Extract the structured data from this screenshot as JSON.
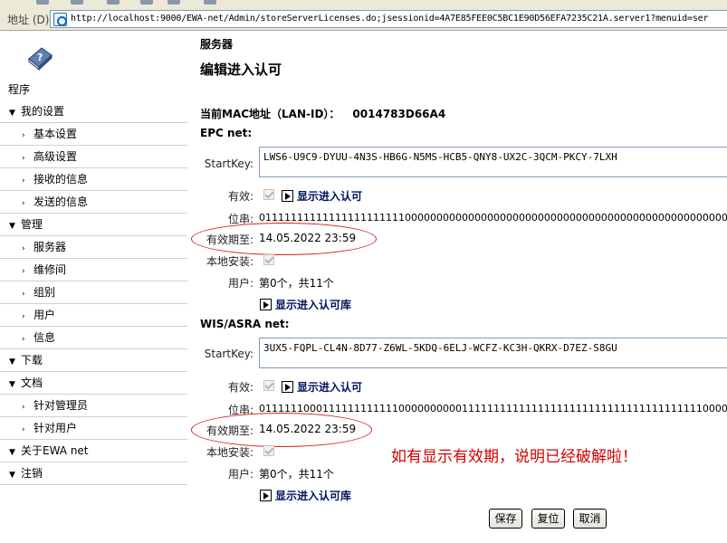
{
  "browser": {
    "address_label": "地址 (D)",
    "url": "http://localhost:9000/EWA-net/Admin/storeServerLicenses.do;jsessionid=4A7E85FEE0C5BC1E90D56EFA7235C21A.server1?menuid=ser"
  },
  "sidebar": {
    "logo_label": "程序",
    "items": [
      {
        "label": "我的设置",
        "level": "top",
        "marker": "▼"
      },
      {
        "label": "基本设置",
        "level": "sub",
        "marker": "›"
      },
      {
        "label": "高级设置",
        "level": "sub",
        "marker": "›"
      },
      {
        "label": "接收的信息",
        "level": "sub",
        "marker": "›"
      },
      {
        "label": "发送的信息",
        "level": "sub",
        "marker": "›"
      },
      {
        "label": "管理",
        "level": "top",
        "marker": "▼"
      },
      {
        "label": "服务器",
        "level": "sub",
        "marker": "›"
      },
      {
        "label": "维修间",
        "level": "sub",
        "marker": "›"
      },
      {
        "label": "组别",
        "level": "sub",
        "marker": "›"
      },
      {
        "label": "用户",
        "level": "sub",
        "marker": "›"
      },
      {
        "label": "信息",
        "level": "sub",
        "marker": "›"
      },
      {
        "label": "下载",
        "level": "top",
        "marker": "▼"
      },
      {
        "label": "文档",
        "level": "top",
        "marker": "▼"
      },
      {
        "label": "针对管理员",
        "level": "sub",
        "marker": "›"
      },
      {
        "label": "针对用户",
        "level": "sub",
        "marker": "›"
      },
      {
        "label": "关于EWA net",
        "level": "top",
        "marker": "▼"
      },
      {
        "label": "注销",
        "level": "top",
        "marker": "▼"
      }
    ]
  },
  "main": {
    "section": "服务器",
    "title": "编辑进入认可",
    "mac_label": "当前MAC地址（LAN-ID）：",
    "mac_value": "0014783D66A4",
    "epc": {
      "heading": "EPC net:",
      "startkey_label": "StartKey:",
      "startkey": "LWS6-U9C9-DYUU-4N3S-HB6G-N5MS-HCB5-QNY8-UX2C-3QCM-PKCY-7LXH",
      "valid_label": "有效:",
      "show_license": "显示进入认可",
      "bits_label": "位串:",
      "bits": "011111111111111111111110000000000000000000000000000000000000000000000000000000000000000000000000000",
      "expiry_label": "有效期至:",
      "expiry": "14.05.2022 23:59",
      "local_label": "本地安装:",
      "users_label": "用户:",
      "users": "第0个，共11个",
      "show_library": "显示进入认可库"
    },
    "wis": {
      "heading": "WIS/ASRA net:",
      "startkey_label": "StartKey:",
      "startkey": "3UX5-FQPL-CL4N-8D77-Z6WL-5KDQ-6ELJ-WCFZ-KC3H-QKRX-D7EZ-S8GU",
      "valid_label": "有效:",
      "show_license": "显示进入认可",
      "bits_label": "位串:",
      "bits": "0111111000111111111111000000000011111111111111111111111111111111111111000000000000000000000000000",
      "expiry_label": "有效期至:",
      "expiry": "14.05.2022 23:59",
      "local_label": "本地安装:",
      "users_label": "用户:",
      "users": "第0个，共11个",
      "show_library": "显示进入认可库"
    },
    "annotation": "如有显示有效期，说明已经破解啦！",
    "buttons": {
      "save": "保存",
      "reset": "复位",
      "cancel": "取消"
    }
  }
}
